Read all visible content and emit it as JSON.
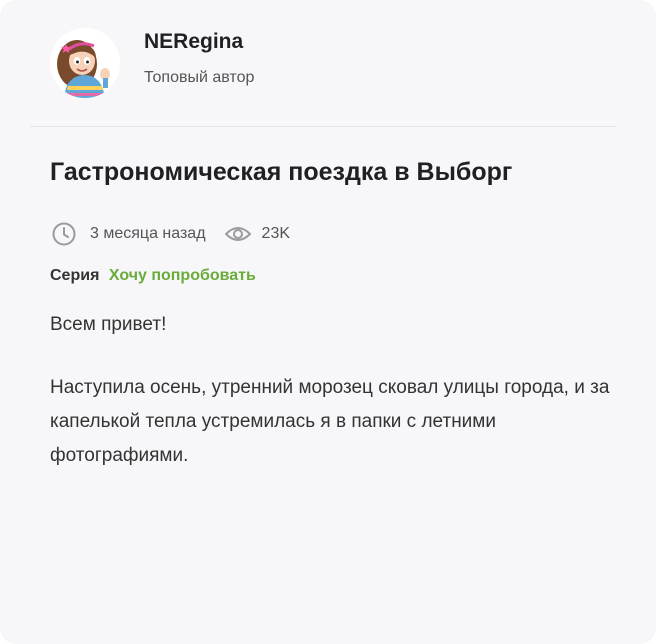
{
  "author": {
    "name": "NERegina",
    "role": "Топовый автор"
  },
  "post": {
    "title": "Гастрономическая поездка в Выборг",
    "meta": {
      "time_icon": "clock-icon",
      "time": "3 месяца назад",
      "views_icon": "eye-icon",
      "views": "23K"
    },
    "series": {
      "label": "Серия",
      "name": "Хочу попробовать"
    },
    "paragraphs": [
      "Всем привет!",
      "Наступила осень, утренний морозец сковал улицы города, и за капелькой тепла устремилась я в папки с летними фотографиями."
    ]
  },
  "colors": {
    "background": "#f7f7fa",
    "series_link": "#6aab3a",
    "text": "#333333"
  }
}
